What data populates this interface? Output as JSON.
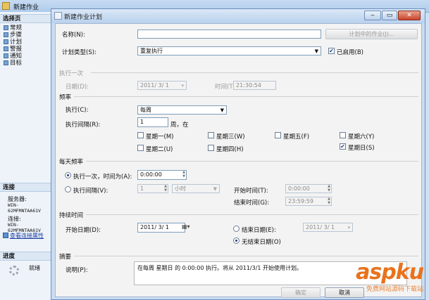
{
  "background_window": {
    "title": "新建作业",
    "select_page_header": "选择页",
    "pages": [
      "常规",
      "步骤",
      "计划",
      "警报",
      "通知",
      "目标"
    ],
    "connection_header": "连接",
    "server_label": "服务器:",
    "server_value": "WIN-62MFMNTAA61V",
    "connection_label": "连接:",
    "connection_value": "WIN-62MFMNTAA61V",
    "view_connection_link": "查看连接属性",
    "progress_header": "进度",
    "progress_status": "就绪"
  },
  "dialog": {
    "title": "新建作业计划",
    "window_buttons": {
      "minimize": "‒",
      "maximize": "▭",
      "close": "✕"
    },
    "name_label": "名称(N):",
    "name_value": "",
    "jobs_in_schedule_button": "计划中的作业(J)...",
    "schedule_type_label": "计划类型(S):",
    "schedule_type_value": "重复执行",
    "enabled_label": "已启用(B)",
    "enabled_checked": true,
    "one_time": {
      "header": "执行一次",
      "date_label": "日期(D):",
      "date_value": "2011/ 3/ 1",
      "time_label": "时间(T):",
      "time_value": "21:30:54"
    },
    "frequency": {
      "header": "频率",
      "occurs_label": "执行(C):",
      "occurs_value": "每周",
      "recurs_label": "执行间隔(R):",
      "recurs_value": "1",
      "recurs_unit": "周，在",
      "days": [
        {
          "label": "星期一(M)",
          "checked": false
        },
        {
          "label": "星期二(U)",
          "checked": false
        },
        {
          "label": "星期三(W)",
          "checked": false
        },
        {
          "label": "星期四(H)",
          "checked": false
        },
        {
          "label": "星期五(F)",
          "checked": false
        },
        {
          "label": "星期六(Y)",
          "checked": false
        },
        {
          "label": "星期日(S)",
          "checked": true
        }
      ]
    },
    "daily_frequency": {
      "header": "每天频率",
      "once_label": "执行一次，时间为(A):",
      "once_value": "0:00:00",
      "once_selected": true,
      "every_label": "执行间隔(V):",
      "every_value": "1",
      "every_unit": "小时",
      "start_time_label": "开始时间(T):",
      "start_time_value": "0:00:00",
      "end_time_label": "结束时间(G):",
      "end_time_value": "23:59:59"
    },
    "duration": {
      "header": "持续时间",
      "start_date_label": "开始日期(D):",
      "start_date_value": "2011/ 3/ 1",
      "end_date_label": "结束日期(E):",
      "end_date_value": "2011/ 3/ 1",
      "no_end_date_label": "无结束日期(O)",
      "no_end_selected": true
    },
    "summary": {
      "header": "摘要",
      "description_label": "说明(P):",
      "description_value": "在每周 星期日 的 0:00:00 执行。将从 2011/3/1 开始使用计划。"
    },
    "ok_button": "确定",
    "cancel_button": "取消"
  },
  "watermark": {
    "logo": "aspku",
    "tagline": "免费网站源码下载站"
  }
}
